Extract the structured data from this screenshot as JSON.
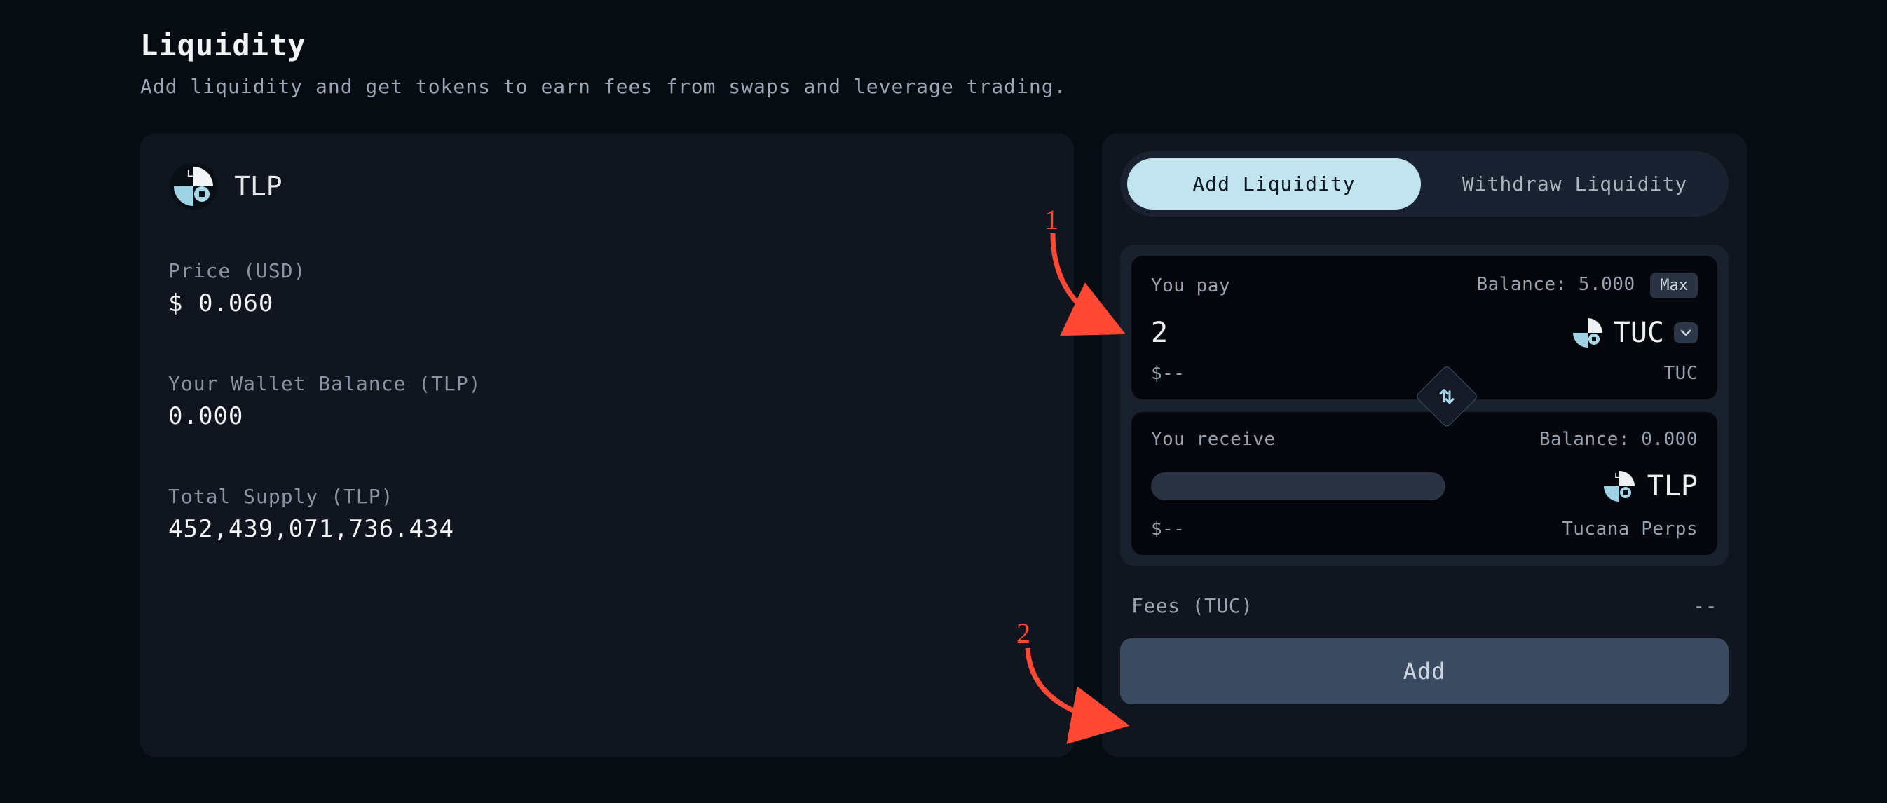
{
  "page": {
    "title": "Liquidity",
    "subtitle": "Add liquidity and get tokens to earn fees from swaps and leverage trading."
  },
  "pool": {
    "symbol": "TLP",
    "price_label": "Price (USD)",
    "price_value": "$ 0.060",
    "wallet_label": "Your Wallet Balance (TLP)",
    "wallet_value": "0.000",
    "supply_label": "Total Supply (TLP)",
    "supply_value": "452,439,071,736.434"
  },
  "tabs": {
    "add": "Add Liquidity",
    "withdraw": "Withdraw Liquidity"
  },
  "swap": {
    "pay_label": "You pay",
    "pay_balance": "Balance: 5.000",
    "pay_max": "Max",
    "pay_amount": "2",
    "pay_token": "TUC",
    "pay_fiat": "$--",
    "pay_token_full": "TUC",
    "receive_label": "You receive",
    "receive_balance": "Balance: 0.000",
    "receive_token": "TLP",
    "receive_fiat": "$--",
    "receive_token_full": "Tucana Perps"
  },
  "fees": {
    "label": "Fees (TUC)",
    "value": "--"
  },
  "submit": "Add",
  "annotations": {
    "one": "1",
    "two": "2"
  }
}
